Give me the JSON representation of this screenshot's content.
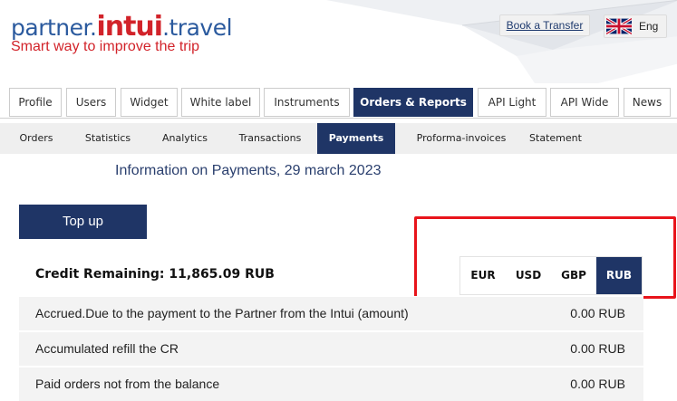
{
  "header": {
    "logo_prefix": "partner.",
    "logo_brand": "intui",
    "logo_suffix": ".travel",
    "tagline": "Smart way to improve the trip",
    "book_transfer": "Book a Transfer",
    "language": "Eng",
    "language_flag": "uk-flag-icon"
  },
  "main_tabs": [
    {
      "label": "Profile"
    },
    {
      "label": "Users"
    },
    {
      "label": "Widget"
    },
    {
      "label": "White label"
    },
    {
      "label": "Instruments"
    },
    {
      "label": "Orders & Reports",
      "active": true
    },
    {
      "label": "API Light"
    },
    {
      "label": "API Wide"
    },
    {
      "label": "News"
    }
  ],
  "sub_tabs": [
    {
      "label": "Orders"
    },
    {
      "label": "Statistics"
    },
    {
      "label": "Analytics"
    },
    {
      "label": "Transactions"
    },
    {
      "label": "Payments",
      "active": true
    },
    {
      "label": "Proforma-invoices"
    },
    {
      "label": "Statement"
    }
  ],
  "content": {
    "title": "Information on Payments, 29 march 2023",
    "topup_label": "Top up",
    "credit_remaining": "Credit Remaining: 11,865.09 RUB",
    "currencies": [
      {
        "label": "EUR"
      },
      {
        "label": "USD"
      },
      {
        "label": "GBP"
      },
      {
        "label": "RUB",
        "active": true
      }
    ],
    "rows": [
      {
        "label": "Accrued.Due to the payment to the Partner from the Intui (amount)",
        "value": "0.00 RUB"
      },
      {
        "label": "Accumulated refill the CR",
        "value": "0.00 RUB"
      },
      {
        "label": "Paid orders not from the balance",
        "value": "0.00 RUB"
      }
    ]
  },
  "colors": {
    "navy": "#1f3566",
    "brand_red": "#d2232a",
    "brand_blue": "#2b5a9e",
    "highlight_red": "#e8141b"
  }
}
